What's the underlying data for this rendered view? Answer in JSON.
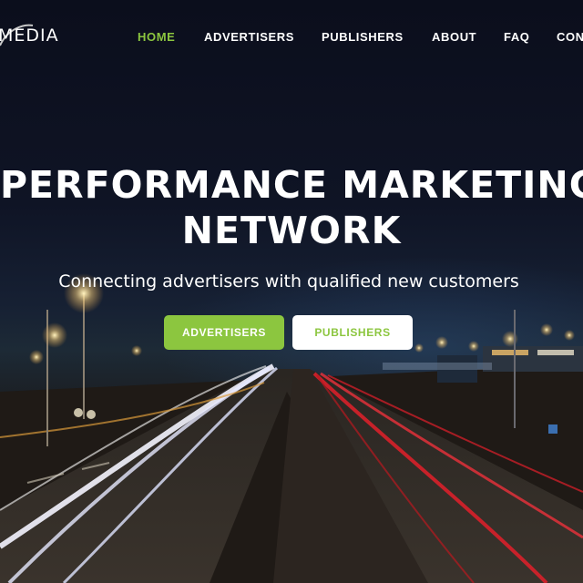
{
  "brand": {
    "logo_text": "MEDIA"
  },
  "nav": {
    "items": [
      {
        "label": "HOME",
        "active": true
      },
      {
        "label": "ADVERTISERS",
        "active": false
      },
      {
        "label": "PUBLISHERS",
        "active": false
      },
      {
        "label": "ABOUT",
        "active": false
      },
      {
        "label": "FAQ",
        "active": false
      },
      {
        "label": "CON",
        "active": false
      }
    ]
  },
  "hero": {
    "headline_line1": "PERFORMANCE MARKETING",
    "headline_line2": "NETWORK",
    "subtitle": "Connecting advertisers with qualified new customers",
    "cta_primary": "ADVERTISERS",
    "cta_secondary": "PUBLISHERS"
  },
  "colors": {
    "accent": "#8cc63f",
    "background": "#0c0f1d",
    "text": "#ffffff"
  }
}
